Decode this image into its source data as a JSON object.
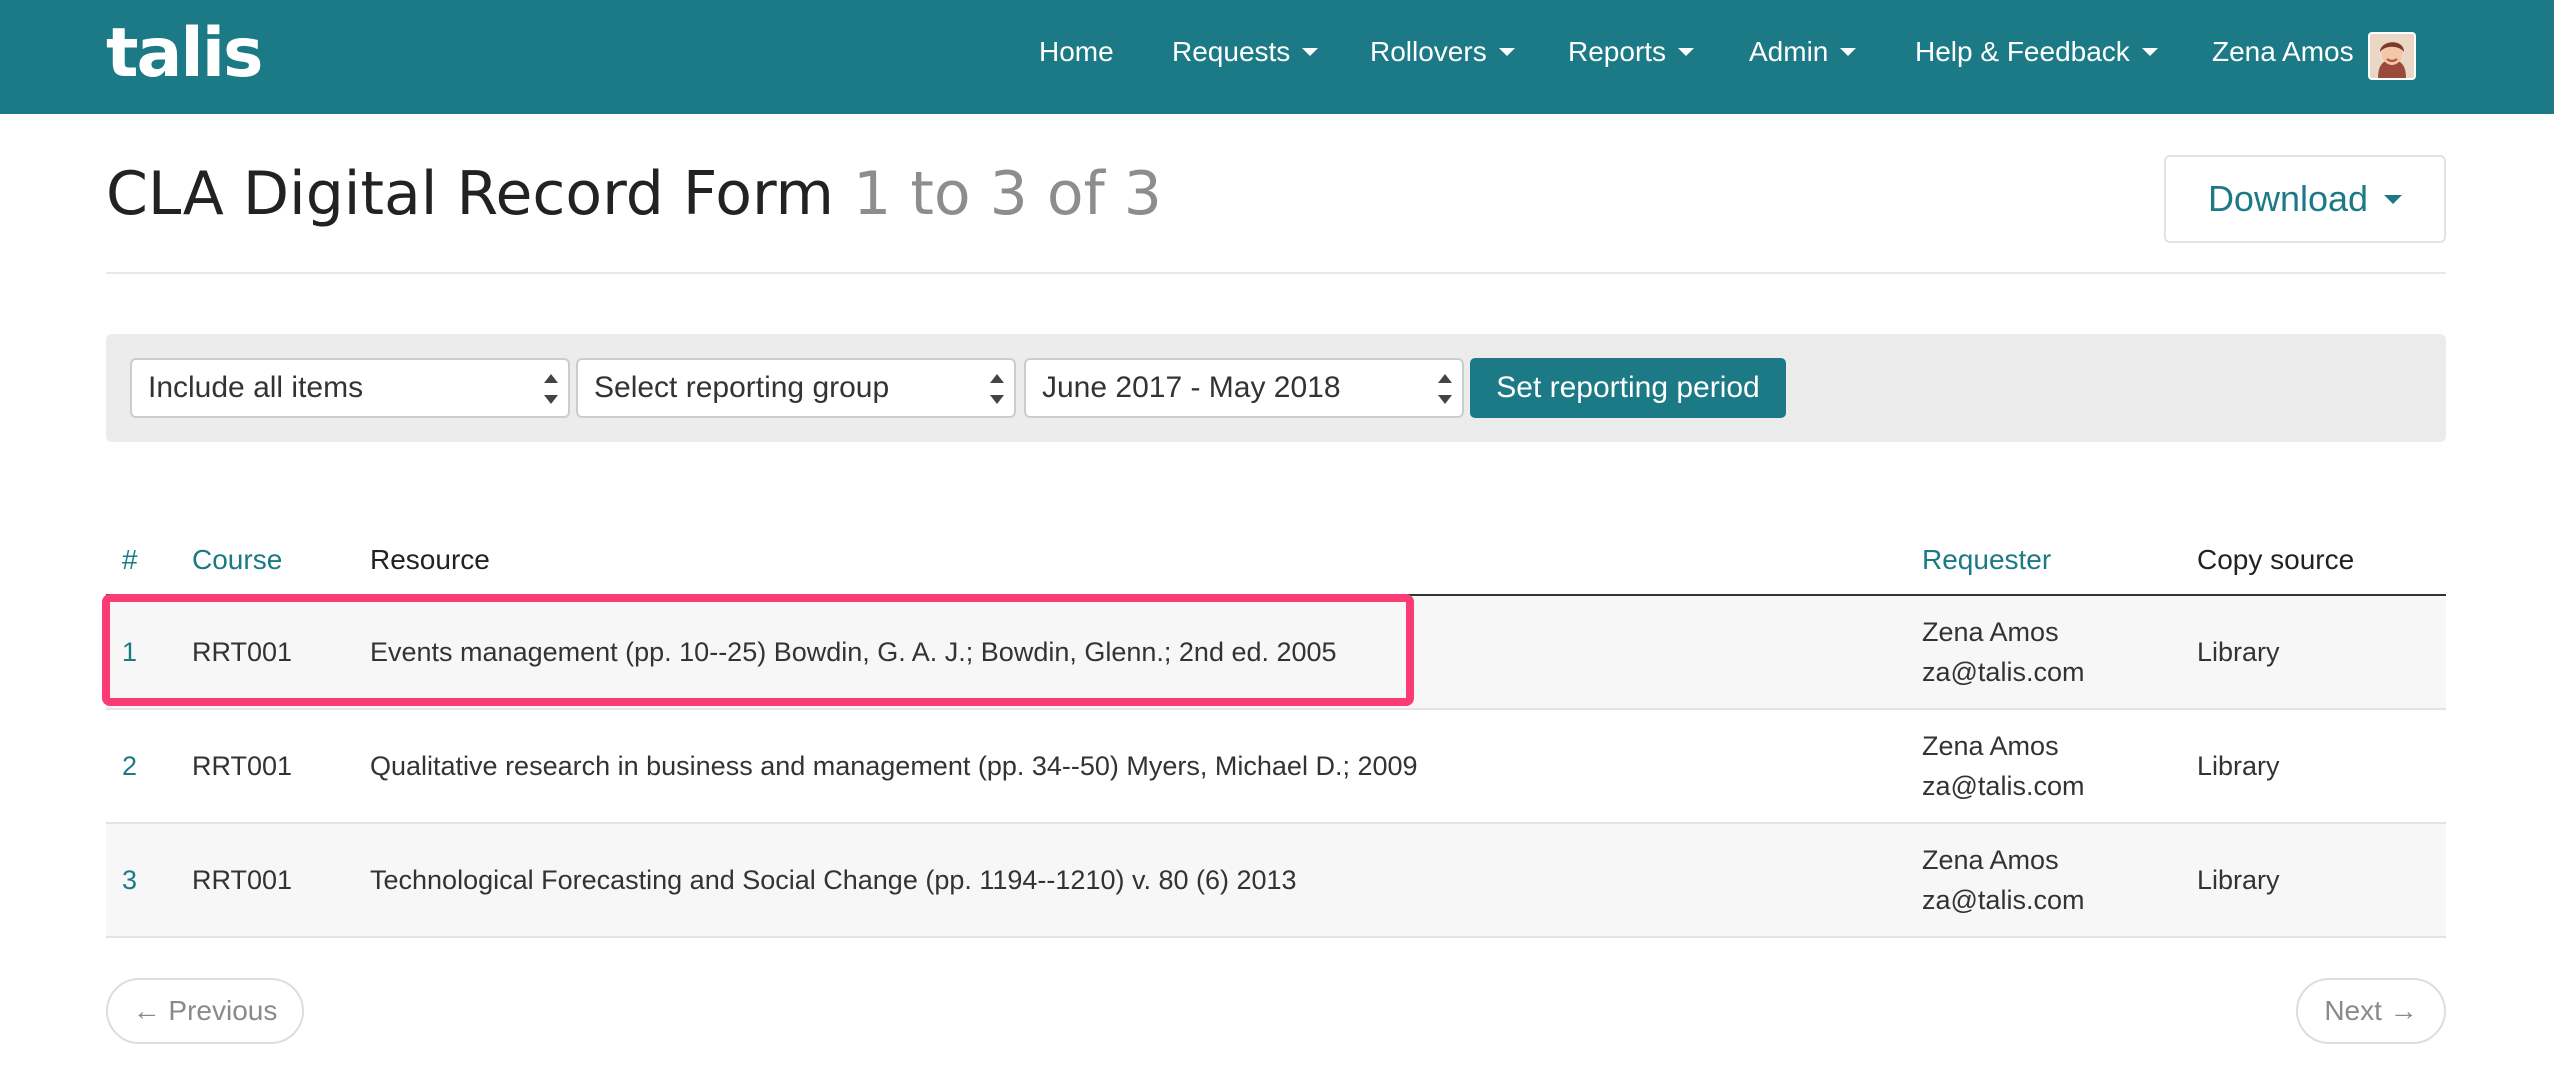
{
  "brand": {
    "logo_text": "talis"
  },
  "nav": {
    "items": [
      {
        "label": "Home",
        "dropdown": false
      },
      {
        "label": "Requests",
        "dropdown": true
      },
      {
        "label": "Rollovers",
        "dropdown": true
      },
      {
        "label": "Reports",
        "dropdown": true
      },
      {
        "label": "Admin",
        "dropdown": true
      },
      {
        "label": "Help & Feedback",
        "dropdown": true
      }
    ],
    "user_name": "Zena Amos"
  },
  "header": {
    "title": "CLA Digital Record Form",
    "count": "1 to 3 of 3",
    "download_label": "Download"
  },
  "filters": {
    "include_value": "Include all items",
    "group_value": "Select reporting group",
    "period_value": "June 2017 - May 2018",
    "set_button": "Set reporting period"
  },
  "table": {
    "headers": {
      "num": "#",
      "course": "Course",
      "resource": "Resource",
      "requester": "Requester",
      "copy_source": "Copy source"
    },
    "rows": [
      {
        "num": "1",
        "course": "RRT001",
        "resource": "Events management (pp. 10--25) Bowdin, G. A. J.; Bowdin, Glenn.; 2nd ed. 2005",
        "requester_name": "Zena Amos",
        "requester_email": "za@talis.com",
        "copy_source": "Library"
      },
      {
        "num": "2",
        "course": "RRT001",
        "resource": "Qualitative research in business and management (pp. 34--50) Myers, Michael D.; 2009",
        "requester_name": "Zena Amos",
        "requester_email": "za@talis.com",
        "copy_source": "Library"
      },
      {
        "num": "3",
        "course": "RRT001",
        "resource": "Technological Forecasting and Social Change (pp. 1194--1210) v. 80 (6) 2013",
        "requester_name": "Zena Amos",
        "requester_email": "za@talis.com",
        "copy_source": "Library"
      }
    ]
  },
  "pager": {
    "previous": "← Previous",
    "next": "Next →"
  },
  "colors": {
    "brand": "#1c7a86",
    "highlight": "#fb3b74"
  }
}
